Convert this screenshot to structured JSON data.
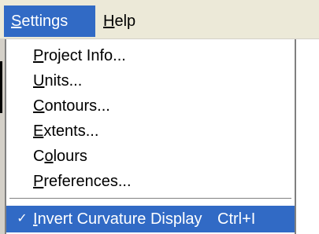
{
  "menubar": {
    "settings": {
      "label": "Settings",
      "accel": "S",
      "rest": "ettings"
    },
    "help": {
      "label": "Help",
      "accel": "H",
      "rest": "elp"
    }
  },
  "dropdown": {
    "items": [
      {
        "label": "Project Info...",
        "pre": "",
        "accel": "P",
        "rest": "roject Info..."
      },
      {
        "label": "Units...",
        "pre": "",
        "accel": "U",
        "rest": "nits..."
      },
      {
        "label": "Contours...",
        "pre": "",
        "accel": "C",
        "rest": "ontours..."
      },
      {
        "label": "Extents...",
        "pre": "",
        "accel": "E",
        "rest": "xtents..."
      },
      {
        "label": "Colours",
        "pre": "C",
        "accel": "o",
        "rest": "lours"
      },
      {
        "label": "Preferences...",
        "pre": "",
        "accel": "P",
        "rest": "references..."
      }
    ],
    "checked_item": {
      "label": "Invert Curvature Display",
      "pre": "",
      "accel": "I",
      "rest": "nvert Curvature Display",
      "shortcut": "Ctrl+I",
      "checkmark": "✓",
      "checked": true
    }
  },
  "colors": {
    "highlight": "#316ac5",
    "menubar_bg": "#ece9d8"
  }
}
